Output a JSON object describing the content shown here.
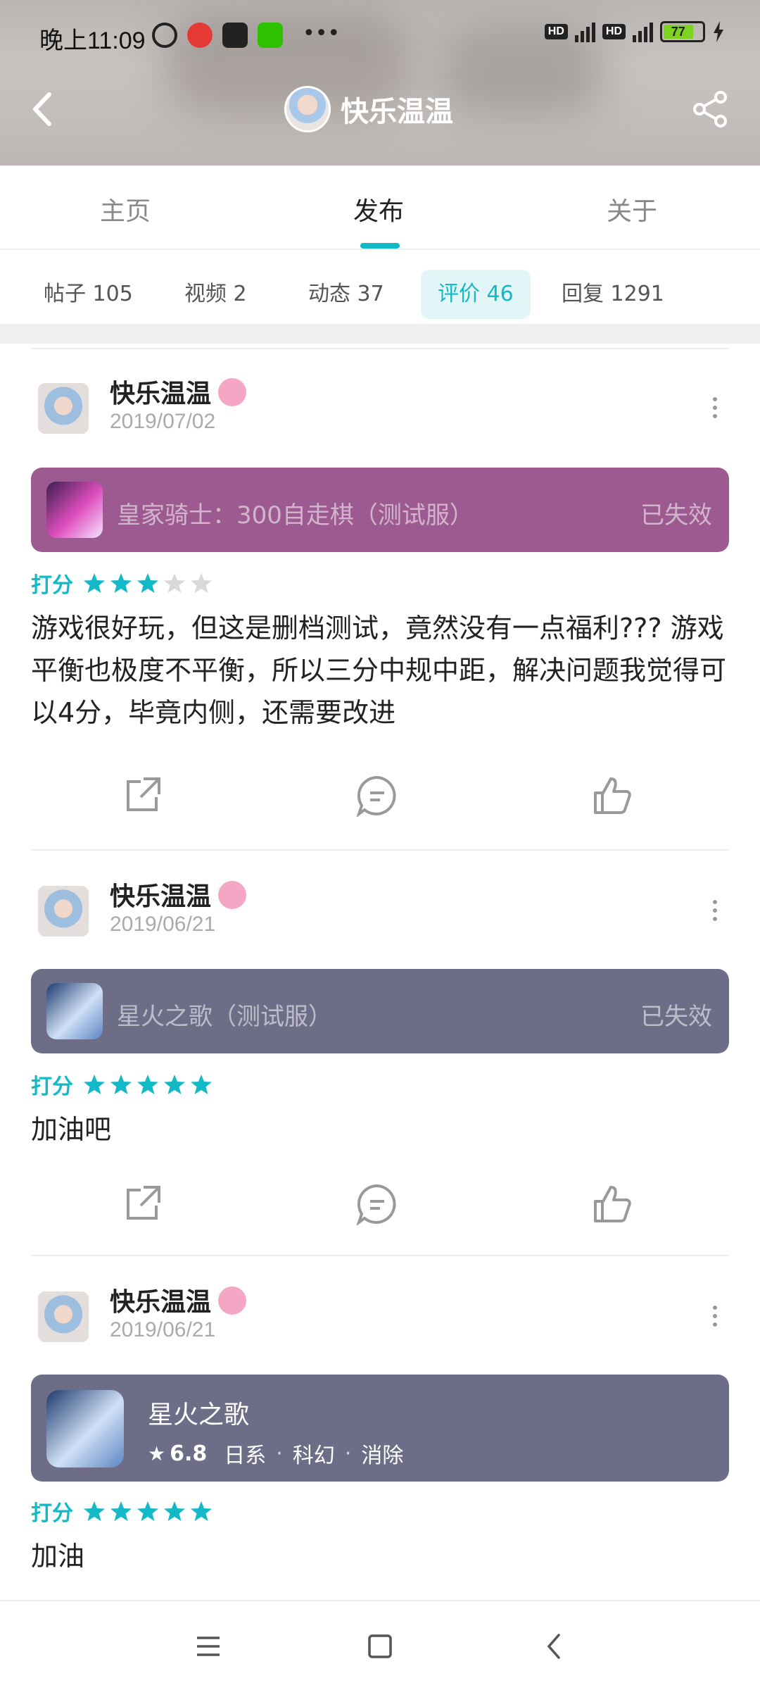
{
  "status_bar": {
    "time": "晚上11:09",
    "battery": "77"
  },
  "header": {
    "title": "快乐温温"
  },
  "main_tabs": [
    {
      "label": "主页",
      "active": false
    },
    {
      "label": "发布",
      "active": true
    },
    {
      "label": "关于",
      "active": false
    }
  ],
  "sub_tabs": [
    {
      "label": "帖子 105",
      "active": false
    },
    {
      "label": "视频 2",
      "active": false
    },
    {
      "label": "动态 37",
      "active": false
    },
    {
      "label": "评价 46",
      "active": true
    },
    {
      "label": "回复 1291",
      "active": false
    }
  ],
  "posts": [
    {
      "author": "快乐温温",
      "date": "2019/07/02",
      "game": {
        "name": "皇家骑士：300自走棋（测试服）",
        "status": "已失效",
        "color": "#9c5a91"
      },
      "rating_label": "打分",
      "rating": 3,
      "text": "游戏很好玩，但这是删档测试，竟然没有一点福利??? 游戏平衡也极度不平衡，所以三分中规中距，解决问题我觉得可以4分，毕竟内侧，还需要改进"
    },
    {
      "author": "快乐温温",
      "date": "2019/06/21",
      "game": {
        "name": "星火之歌（测试服）",
        "status": "已失效",
        "color": "#6e6d87"
      },
      "rating_label": "打分",
      "rating": 5,
      "text": "加油吧"
    },
    {
      "author": "快乐温温",
      "date": "2019/06/21",
      "game": {
        "name": "星火之歌",
        "score": "6.8",
        "tags": [
          "日系",
          "科幻",
          "消除"
        ],
        "color": "#6e6d87"
      },
      "rating_label": "打分",
      "rating": 5,
      "text": "加油"
    }
  ],
  "colors": {
    "accent": "#14b9c8",
    "star_off": "#d9d9d9"
  }
}
